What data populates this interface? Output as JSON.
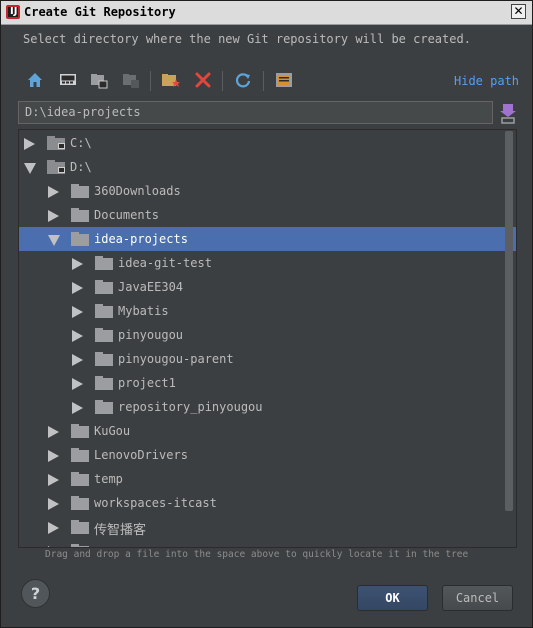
{
  "window": {
    "title": "Create Git Repository",
    "close_glyph": "✕",
    "app_icon_letter": "IJ"
  },
  "description": "Select directory where the new Git repository will be created.",
  "toolbar": {
    "buttons": [
      {
        "name": "home-icon"
      },
      {
        "name": "desktop-icon"
      },
      {
        "name": "project-icon"
      },
      {
        "name": "module-icon"
      },
      {
        "name": "new-folder-icon"
      },
      {
        "name": "delete-icon"
      },
      {
        "name": "refresh-icon"
      },
      {
        "name": "show-hidden-icon"
      }
    ],
    "hide_path_label": "Hide path"
  },
  "path_field": {
    "value": "D:\\idea-projects"
  },
  "tree": {
    "rows": [
      {
        "label": "C:\\",
        "kind": "drive",
        "depth": 0,
        "expanded": false
      },
      {
        "label": "D:\\",
        "kind": "drive",
        "depth": 0,
        "expanded": true
      },
      {
        "label": "360Downloads",
        "kind": "folder",
        "depth": 1,
        "expanded": false
      },
      {
        "label": "Documents",
        "kind": "folder",
        "depth": 1,
        "expanded": false
      },
      {
        "label": "idea-projects",
        "kind": "folder",
        "depth": 1,
        "expanded": true,
        "selected": true
      },
      {
        "label": "idea-git-test",
        "kind": "folder",
        "depth": 2,
        "expanded": false
      },
      {
        "label": "JavaEE304",
        "kind": "folder",
        "depth": 2,
        "expanded": false
      },
      {
        "label": "Mybatis",
        "kind": "folder",
        "depth": 2,
        "expanded": false
      },
      {
        "label": "pinyougou",
        "kind": "folder",
        "depth": 2,
        "expanded": false
      },
      {
        "label": "pinyougou-parent",
        "kind": "folder",
        "depth": 2,
        "expanded": false
      },
      {
        "label": "project1",
        "kind": "folder",
        "depth": 2,
        "expanded": false
      },
      {
        "label": "repository_pinyougou",
        "kind": "folder",
        "depth": 2,
        "expanded": false
      },
      {
        "label": "KuGou",
        "kind": "folder",
        "depth": 1,
        "expanded": false
      },
      {
        "label": "LenovoDrivers",
        "kind": "folder",
        "depth": 1,
        "expanded": false
      },
      {
        "label": "temp",
        "kind": "folder",
        "depth": 1,
        "expanded": false
      },
      {
        "label": "workspaces-itcast",
        "kind": "folder",
        "depth": 1,
        "expanded": false
      },
      {
        "label": "传智播客",
        "kind": "folder",
        "depth": 1,
        "expanded": false,
        "cjk": true
      },
      {
        "label": "软件",
        "kind": "folder",
        "depth": 1,
        "expanded": false,
        "cjk": true
      }
    ]
  },
  "hint": "Drag and drop a file into the space above to quickly locate it in the tree",
  "buttons": {
    "help": "?",
    "ok": "OK",
    "cancel": "Cancel"
  },
  "colors": {
    "selection": "#4b6eaf",
    "link": "#589df6",
    "background": "#3c3f41"
  }
}
